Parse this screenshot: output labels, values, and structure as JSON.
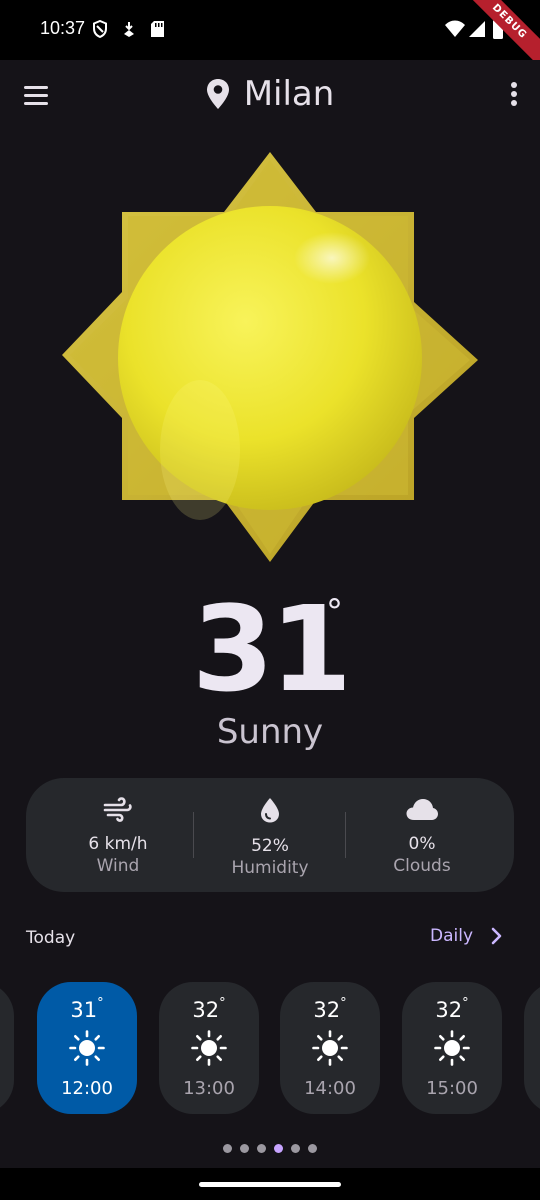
{
  "status_bar": {
    "time": "10:37",
    "debug_label": "DEBUG"
  },
  "header": {
    "city": "Milan"
  },
  "current": {
    "temperature": "31",
    "degree_symbol": "°",
    "condition": "Sunny"
  },
  "stats": [
    {
      "value": "6 km/h",
      "label": "Wind",
      "icon": "wind-icon"
    },
    {
      "value": "52%",
      "label": "Humidity",
      "icon": "droplet-icon"
    },
    {
      "value": "0%",
      "label": "Clouds",
      "icon": "cloud-icon"
    }
  ],
  "today_section": {
    "title": "Today",
    "daily_link": "Daily"
  },
  "hourly": [
    {
      "temp": "31",
      "time": "12:00",
      "active": true,
      "icon": "sun-icon"
    },
    {
      "temp": "32",
      "time": "13:00",
      "active": false,
      "icon": "sun-icon"
    },
    {
      "temp": "32",
      "time": "14:00",
      "active": false,
      "icon": "sun-icon"
    },
    {
      "temp": "32",
      "time": "15:00",
      "active": false,
      "icon": "sun-icon"
    }
  ],
  "pager": {
    "count": 6,
    "active_index": 3
  },
  "colors": {
    "accent": "#cbb7ff",
    "active_card": "#005aa6",
    "card": "#26282c",
    "background": "#151318"
  }
}
